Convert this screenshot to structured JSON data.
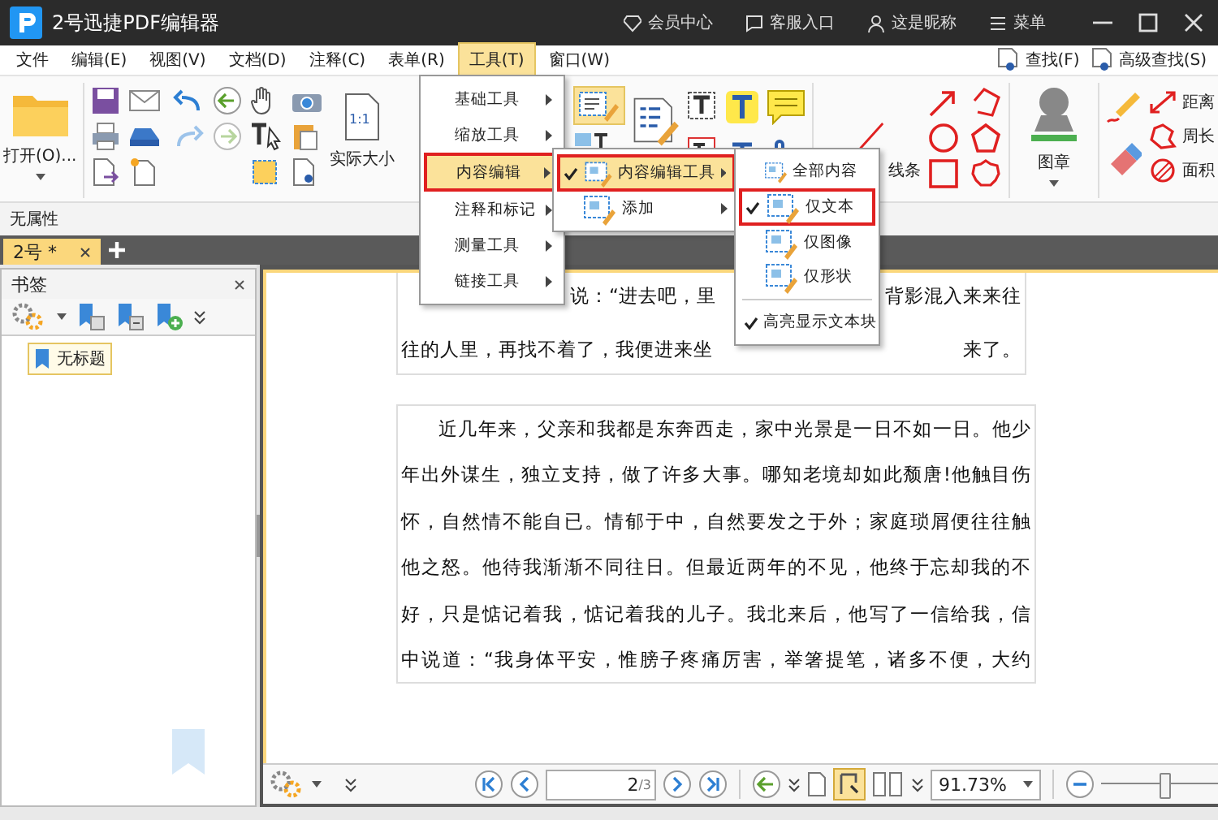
{
  "window": {
    "title": "2号迅捷PDF编辑器",
    "links": [
      {
        "label": "会员中心",
        "kind": "vip"
      },
      {
        "label": "客服入口",
        "kind": "service"
      },
      {
        "label": "这是昵称",
        "kind": "user"
      },
      {
        "label": "菜单",
        "kind": "menu"
      }
    ]
  },
  "menu_bar": {
    "items": [
      {
        "label": "文件",
        "selected": false
      },
      {
        "label": "编辑(E)",
        "selected": false
      },
      {
        "label": "视图(V)",
        "selected": false
      },
      {
        "label": "文档(D)",
        "selected": false
      },
      {
        "label": "注释(C)",
        "selected": false
      },
      {
        "label": "表单(R)",
        "selected": false
      },
      {
        "label": "工具(T)",
        "selected": true
      },
      {
        "label": "窗口(W)",
        "selected": false
      }
    ],
    "search": [
      {
        "label": "查找(F)"
      },
      {
        "label": "高级查找(S)"
      }
    ]
  },
  "ribbon": {
    "open_label": "打开(O)...",
    "actual_size_icon_text": "1:1",
    "actual_size_label": "实际大小",
    "line_label": "线条",
    "stamp_label": "图章",
    "measure": [
      {
        "label": "距离"
      },
      {
        "label": "周长"
      },
      {
        "label": "面积"
      }
    ]
  },
  "property_bar": {
    "text": "无属性"
  },
  "tabs": [
    {
      "label": "2号 *",
      "selected": true
    }
  ],
  "bookmarks": {
    "title": "书签",
    "items": [
      {
        "label": "无标题",
        "selected": true
      }
    ]
  },
  "document": {
    "paragraph_1_lines": [
      {
        "fragments": [
          "说：“进去吧，里",
          "背影混入来来往"
        ]
      },
      {
        "fragments": [
          "往的人里，再找不着了，我便进来坐",
          "来了。"
        ]
      }
    ],
    "paragraph_2_lines": [
      "近几年来，父亲和我都是东奔西走，家中光景是一日不如一日。他少",
      "年出外谋生，独立支持，做了许多大事。哪知老境却如此颓唐!他触目伤",
      "怀，自然情不能自已。情郁于中，自然要发之于外；家庭琐屑便往往触",
      "他之怒。他待我渐渐不同往日。但最近两年的不见，他终于忘却我的不",
      "好，只是惦记着我，惦记着我的儿子。我北来后，他写了一信给我，信",
      "中说道：“我身体平安，惟膀子疼痛厉害，举箸提笔，诸多不便，大约"
    ]
  },
  "menus": [
    {
      "items": [
        {
          "label": "基础工具",
          "kind": "plain",
          "selected": false,
          "checked": false,
          "submenu": true
        },
        {
          "label": "缩放工具",
          "kind": "plain",
          "selected": false,
          "checked": false,
          "submenu": true
        },
        {
          "label": "内容编辑",
          "kind": "plain",
          "selected": true,
          "checked": false,
          "submenu": true
        },
        {
          "label": "注释和标记",
          "kind": "plain",
          "selected": false,
          "checked": false,
          "submenu": true
        },
        {
          "label": "测量工具",
          "kind": "plain",
          "selected": false,
          "checked": false,
          "submenu": true
        },
        {
          "label": "链接工具",
          "kind": "plain",
          "selected": false,
          "checked": false,
          "submenu": true
        }
      ]
    },
    {
      "items": [
        {
          "label": "内容编辑工具",
          "kind": "icon",
          "selected": true,
          "checked": true,
          "submenu": true
        },
        {
          "label": "添加",
          "kind": "icon",
          "selected": false,
          "checked": false,
          "submenu": true
        }
      ]
    },
    {
      "items": [
        {
          "label": "全部内容",
          "kind": "icon",
          "selected": false,
          "checked": false,
          "submenu": false
        },
        {
          "label": "仅文本",
          "kind": "icon",
          "selected": true,
          "checked": true,
          "submenu": false
        },
        {
          "label": "仅图像",
          "kind": "icon",
          "selected": false,
          "checked": false,
          "submenu": false
        },
        {
          "label": "仅形状",
          "kind": "icon",
          "selected": false,
          "checked": false,
          "submenu": false
        },
        {
          "label": "高亮显示文本块",
          "kind": "toggle",
          "selected": false,
          "checked": true,
          "submenu": false
        }
      ]
    }
  ],
  "status_bar": {
    "page": "2",
    "page_total": "/3",
    "zoom": "91.73%",
    "zoom_slider": {
      "level": 0.5
    }
  }
}
